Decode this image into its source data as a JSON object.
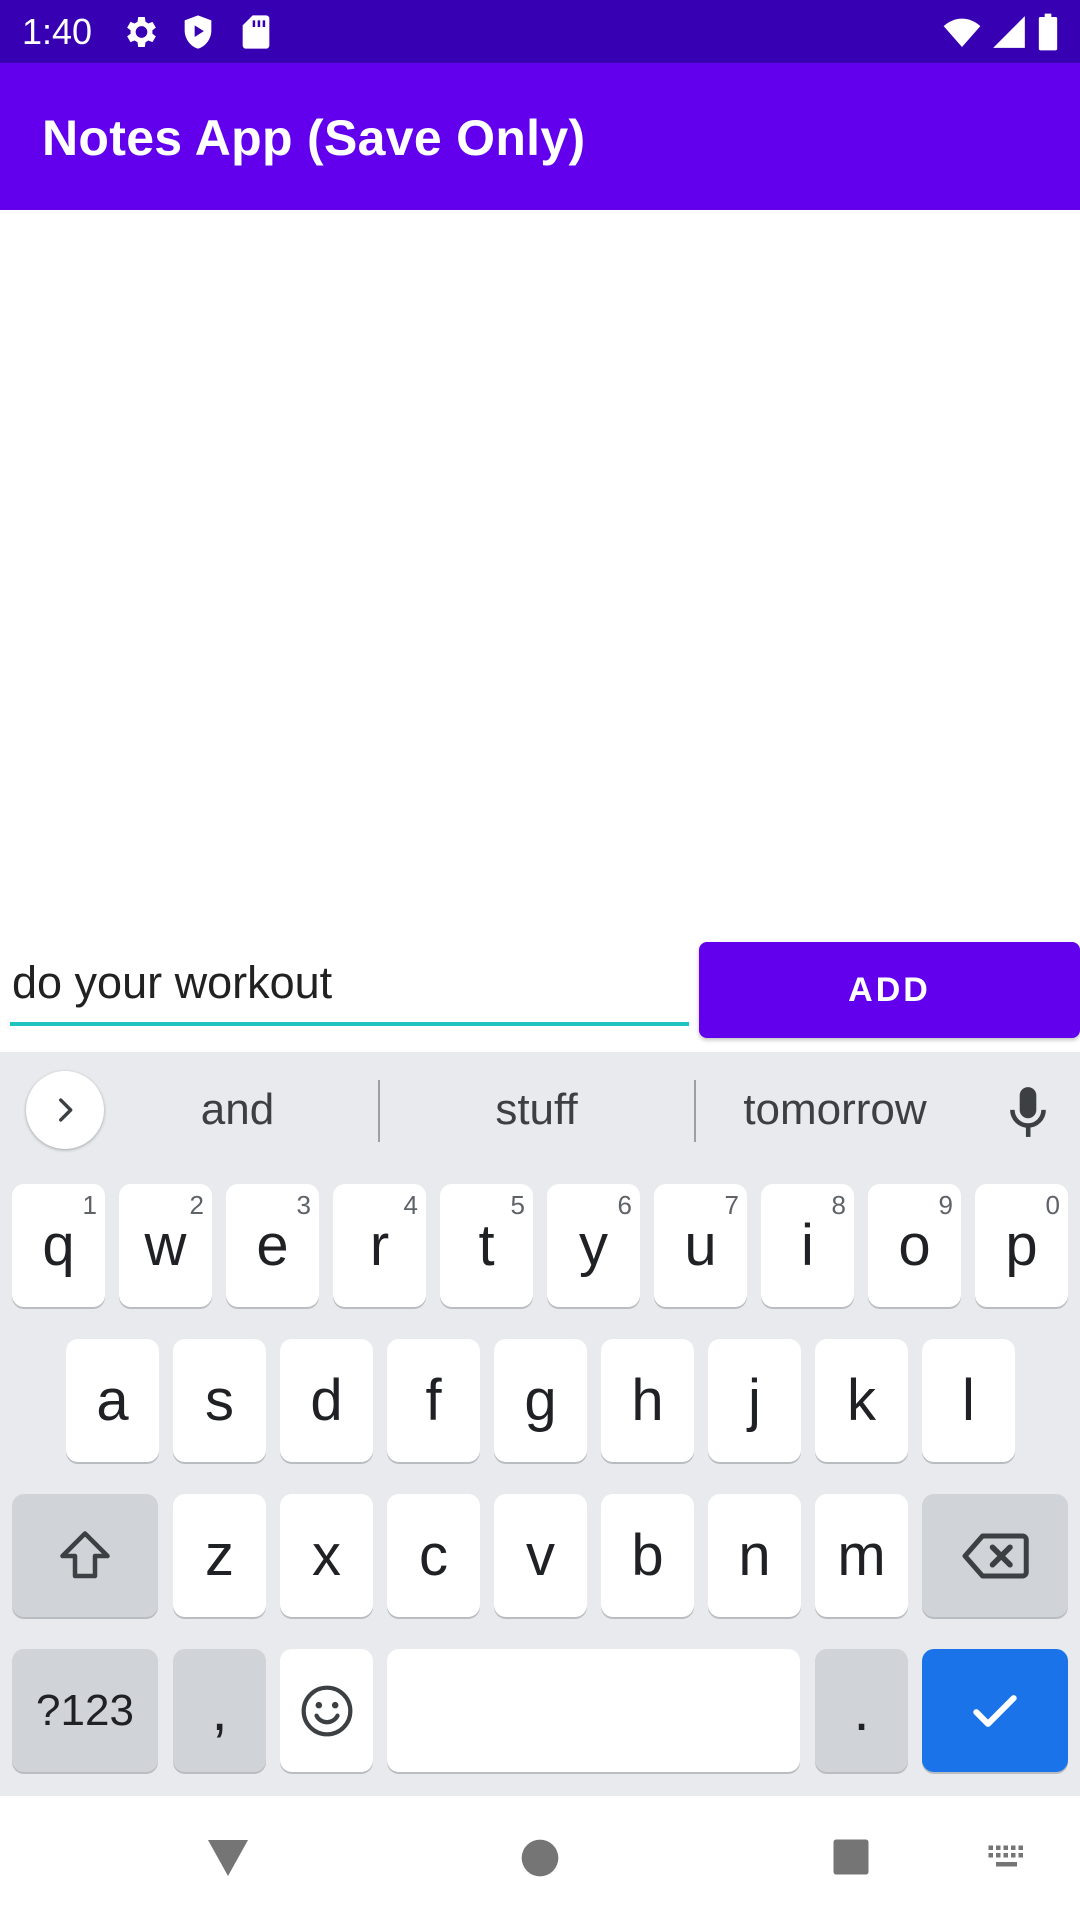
{
  "status_bar": {
    "time": "1:40",
    "left_icons": [
      "gear-icon",
      "shield-play-icon",
      "sd-card-icon"
    ],
    "right_icons": [
      "wifi-icon",
      "signal-icon",
      "battery-icon"
    ],
    "background": "#3700b3"
  },
  "app_bar": {
    "title": "Notes App (Save Only)",
    "background": "#6200ee"
  },
  "input": {
    "value": "do your workout",
    "underline_color": "#1ec5c0"
  },
  "add_button": {
    "label": "ADD",
    "background": "#6200ee"
  },
  "keyboard": {
    "suggestions": [
      "and",
      "stuff",
      "tomorrow"
    ],
    "row1": [
      {
        "letter": "q",
        "hint": "1"
      },
      {
        "letter": "w",
        "hint": "2"
      },
      {
        "letter": "e",
        "hint": "3"
      },
      {
        "letter": "r",
        "hint": "4"
      },
      {
        "letter": "t",
        "hint": "5"
      },
      {
        "letter": "y",
        "hint": "6"
      },
      {
        "letter": "u",
        "hint": "7"
      },
      {
        "letter": "i",
        "hint": "8"
      },
      {
        "letter": "o",
        "hint": "9"
      },
      {
        "letter": "p",
        "hint": "0"
      }
    ],
    "row2": [
      "a",
      "s",
      "d",
      "f",
      "g",
      "h",
      "j",
      "k",
      "l"
    ],
    "row3": [
      "z",
      "x",
      "c",
      "v",
      "b",
      "n",
      "m"
    ],
    "symbols_label": "?123",
    "comma_label": ",",
    "period_label": ".",
    "action_color": "#1a73e8"
  },
  "nav_bar": {
    "icons": [
      "back-icon",
      "home-icon",
      "recents-icon",
      "keyboard-switch-icon"
    ]
  }
}
